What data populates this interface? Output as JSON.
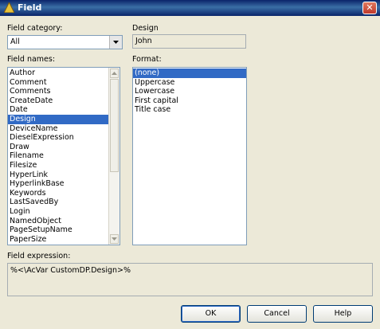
{
  "window": {
    "title": "Field",
    "close_glyph": "✕",
    "icon": "autocad-app-icon"
  },
  "field_category": {
    "label": "Field category:",
    "value": "All"
  },
  "field_names": {
    "label": "Field names:",
    "items": [
      "Author",
      "Comment",
      "Comments",
      "CreateDate",
      "Date",
      "Design",
      "DeviceName",
      "DieselExpression",
      "Draw",
      "Filename",
      "Filesize",
      "HyperLink",
      "HyperlinkBase",
      "Keywords",
      "LastSavedBy",
      "Login",
      "NamedObject",
      "PageSetupName",
      "PaperSize"
    ],
    "selected": "Design"
  },
  "design": {
    "label": "Design",
    "value": "John"
  },
  "format": {
    "label": "Format:",
    "items": [
      "(none)",
      "Uppercase",
      "Lowercase",
      "First capital",
      "Title case"
    ],
    "selected": "(none)"
  },
  "field_expression": {
    "label": "Field expression:",
    "value": "%<\\AcVar CustomDP.Design>%"
  },
  "buttons": {
    "ok": "OK",
    "cancel": "Cancel",
    "help": "Help"
  }
}
